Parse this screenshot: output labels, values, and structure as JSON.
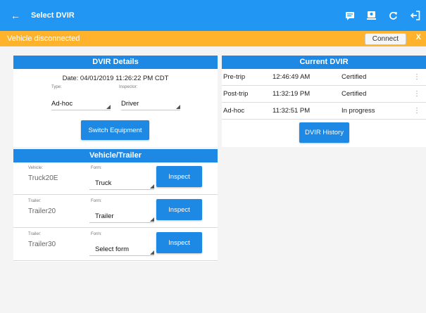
{
  "appbar": {
    "title": "Select DVIR",
    "back_icon": "←",
    "icons": [
      "message-icon",
      "dvir-download-icon",
      "refresh-icon",
      "logout-icon"
    ]
  },
  "banner": {
    "message": "Vehicle disconnected",
    "connect_label": "Connect",
    "close_label": "X",
    "color": "#ffb32c"
  },
  "dvir_details": {
    "header": "DVIR Details",
    "date": "Date: 04/01/2019 11:26:22 PM CDT",
    "type_label": "Type:",
    "type_value": "Ad-hoc",
    "inspector_label": "Inspector:",
    "inspector_value": "Driver",
    "switch_button": "Switch Equipment"
  },
  "vehicle_trailer": {
    "header": "Vehicle/Trailer",
    "rows": [
      {
        "label": "Vehicle:",
        "name": "Truck20E",
        "form_label": "Form:",
        "form_value": "Truck",
        "inspect": "Inspect"
      },
      {
        "label": "Trailer:",
        "name": "Trailer20",
        "form_label": "Form:",
        "form_value": "Trailer",
        "inspect": "Inspect"
      },
      {
        "label": "Trailer:",
        "name": "Trailer30",
        "form_label": "Form:",
        "form_value": "Select form",
        "inspect": "Inspect"
      }
    ]
  },
  "current_dvir": {
    "header": "Current DVIR",
    "rows": [
      {
        "type": "Pre-trip",
        "time": "12:46:49 AM",
        "status": "Certified"
      },
      {
        "type": "Post-trip",
        "time": "11:32:19 PM",
        "status": "Certified"
      },
      {
        "type": "Ad-hoc",
        "time": "11:32:51 PM",
        "status": "In progress"
      }
    ],
    "history_button": "DVIR History"
  },
  "colors": {
    "primary": "#2196f3",
    "section": "#1e88e5"
  }
}
